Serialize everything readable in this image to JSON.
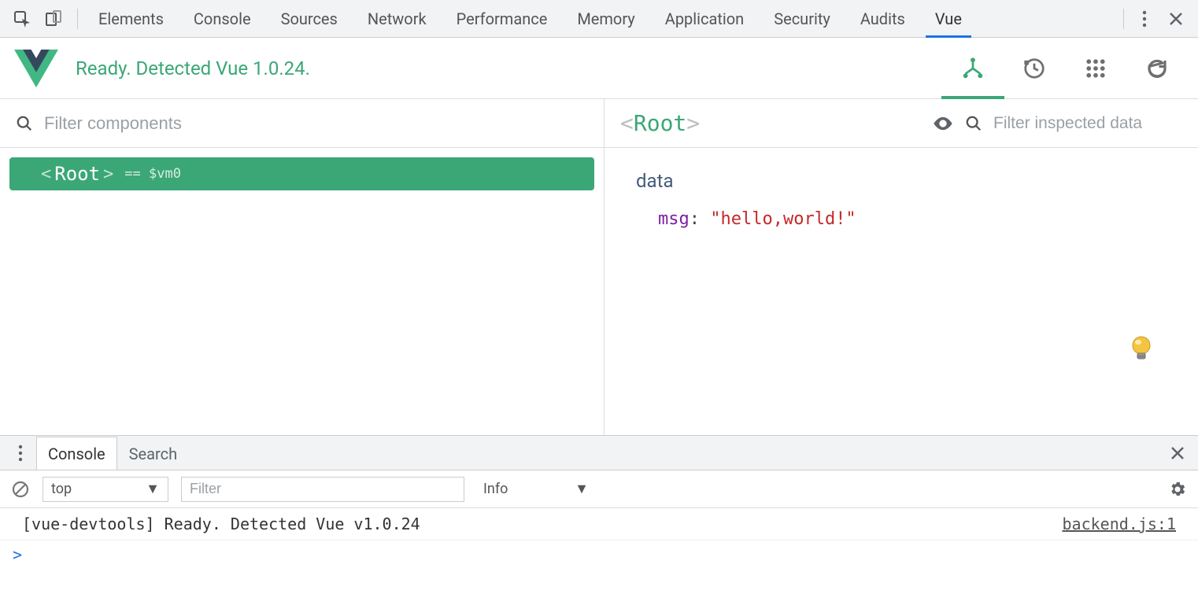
{
  "devtools_tabs": {
    "elements": "Elements",
    "console": "Console",
    "sources": "Sources",
    "network": "Network",
    "performance": "Performance",
    "memory": "Memory",
    "application": "Application",
    "security": "Security",
    "audits": "Audits",
    "vue": "Vue"
  },
  "vue_header": {
    "status": "Ready. Detected Vue 1.0.24."
  },
  "left_panel": {
    "filter_placeholder": "Filter components",
    "tree_root_name": "Root",
    "tree_root_var": "== $vm0"
  },
  "right_panel": {
    "selected_name": "Root",
    "filter_placeholder": "Filter inspected data",
    "section_title": "data",
    "prop_key": "msg",
    "prop_colon": ":",
    "prop_value": "\"hello,world!\""
  },
  "drawer": {
    "tab_console": "Console",
    "tab_search": "Search",
    "context": "top",
    "filter_placeholder": "Filter",
    "level": "Info",
    "log_message": "[vue-devtools] Ready. Detected Vue v1.0.24",
    "log_source": "backend.js:1",
    "prompt": ">"
  }
}
